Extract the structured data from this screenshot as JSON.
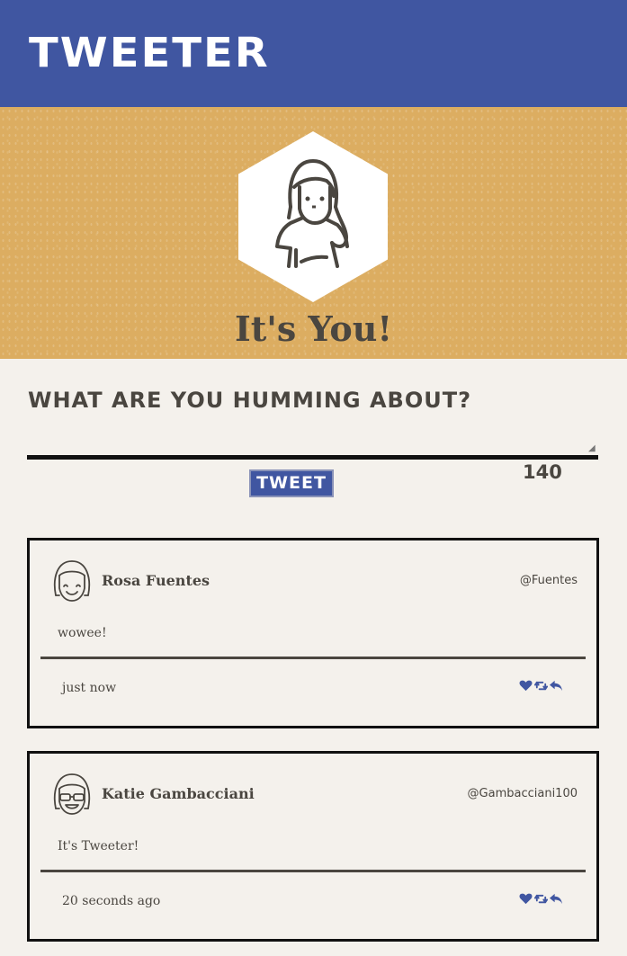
{
  "nav": {
    "brand": "Tweeter"
  },
  "profile": {
    "avatar_icon": "woman-avatar-icon",
    "name": "It's You!"
  },
  "compose": {
    "title": "What are you humming about?",
    "value": "",
    "placeholder": "",
    "button_label": "Tweet",
    "counter": "140"
  },
  "tweets": [
    {
      "avatar_icon": "smiling-girl-avatar-icon",
      "author": "Rosa Fuentes",
      "handle": "@Fuentes",
      "content": "wowee!",
      "time": "just now"
    },
    {
      "avatar_icon": "girl-with-glasses-avatar-icon",
      "author": "Katie Gambacciani",
      "handle": "@Gambacciani100",
      "content": "It's Tweeter!",
      "time": "20 seconds ago"
    }
  ],
  "colors": {
    "nav_bg": "#4056a1",
    "header_bg": "#dcad61",
    "page_bg": "#f4f1ec",
    "text": "#4a4640",
    "action_icon": "#4056a1"
  }
}
